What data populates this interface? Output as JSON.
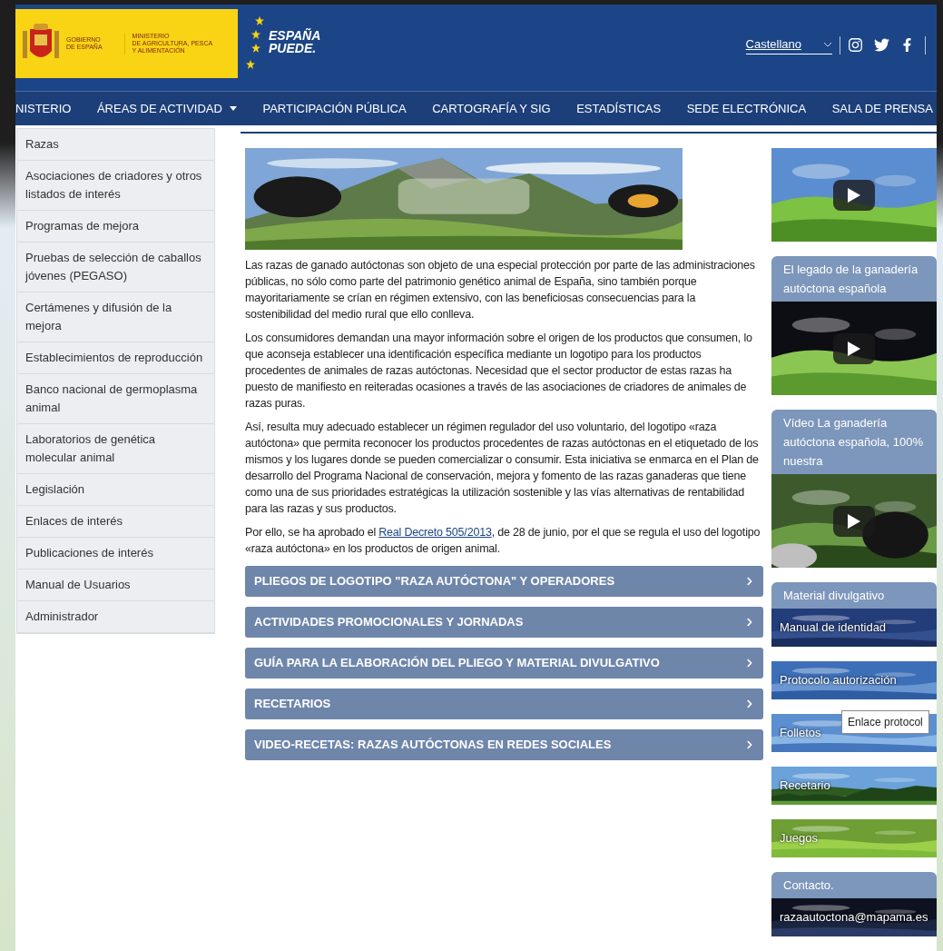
{
  "header": {
    "government_lines": [
      "GOBIERNO",
      "DE ESPAÑA"
    ],
    "ministry_lines": [
      "MINISTERIO",
      "DE AGRICULTURA, PESCA",
      "Y ALIMENTACIÓN"
    ],
    "slogan_lines": [
      "ESPAÑA",
      "PUEDE."
    ],
    "language": {
      "value": "Castellano"
    }
  },
  "nav": [
    {
      "label": "NISTERIO",
      "dropdown": false
    },
    {
      "label": "ÁREAS DE ACTIVIDAD",
      "dropdown": true
    },
    {
      "label": "PARTICIPACIÓN PÚBLICA",
      "dropdown": false
    },
    {
      "label": "CARTOGRAFÍA Y SIG",
      "dropdown": false
    },
    {
      "label": "ESTADÍSTICAS",
      "dropdown": false
    },
    {
      "label": "SEDE ELECTRÓNICA",
      "dropdown": false
    },
    {
      "label": "SALA DE PRENSA",
      "dropdown": false
    }
  ],
  "sidebar": {
    "items": [
      "Razas",
      "Asociaciones de criadores y otros listados de interés",
      "Programas de mejora",
      "Pruebas de selección de caballos jóvenes (PEGASO)",
      "Certámenes y difusión de la mejora",
      "Establecimientos de reproducción",
      "Banco nacional de germoplasma animal",
      "Laboratorios de genética molecular animal",
      "Legislación",
      "Enlaces de interés",
      "Publicaciones de interés",
      "Manual de Usuarios",
      "Administrador"
    ]
  },
  "paragraphs": [
    {
      "kind": "text",
      "text": "Las razas de ganado autóctonas son objeto de una especial protección por parte de las administraciones públicas, no sólo como parte del patrimonio genético animal de España, sino también porque mayoritariamente se crían en régimen extensivo, con las beneficiosas consecuencias para la sostenibilidad del medio rural que ello conlleva."
    },
    {
      "kind": "text",
      "text": "Los consumidores demandan una mayor información sobre el origen de los productos que consumen, lo que aconseja establecer una identificación específica mediante un logotipo para los productos procedentes de animales de razas autóctonas. Necesidad que el sector productor de estas razas ha puesto de manifiesto en reiteradas ocasiones a través de las asociaciones de criadores de animales de razas puras."
    },
    {
      "kind": "text",
      "text": "Así, resulta muy adecuado establecer un régimen regulador del uso voluntario, del logotipo «raza autóctona» que permita reconocer los productos procedentes de razas autóctonas en el etiquetado de los mismos y los lugares donde se pueden comercializar o consumir. Esta iniciativa se enmarca en el Plan de desarrollo del Programa Nacional de conservación, mejora y fomento de las razas ganaderas que tiene como una de sus prioridades estratégicas la utilización sostenible y las vías alternativas de rentabilidad para las razas y sus productos."
    },
    {
      "kind": "with_link",
      "before": "Por ello, se ha aprobado el ",
      "link": "Real Decreto 505/2013",
      "after": ", de 28 de junio, por el que se regula el uso del logotipo «raza autóctona» en los productos de origen animal."
    }
  ],
  "sections": [
    "PLIEGOS DE LOGOTIPO \"RAZA AUTÓCTONA\" Y OPERADORES",
    "ACTIVIDADES PROMOCIONALES Y JORNADAS",
    "GUÍA PARA LA ELABORACIÓN DEL PLIEGO Y MATERIAL DIVULGATIVO",
    "RECETARIOS",
    "VIDEO-RECETAS: RAZAS AUTÓCTONAS EN REDES SOCIALES"
  ],
  "panels": [
    {
      "kind": "video"
    },
    {
      "kind": "video",
      "title": "El legado de la ganadería autóctona española"
    },
    {
      "kind": "video",
      "title": "Vídeo La ganadería autóctona española, 100% nuestra"
    },
    {
      "kind": "link",
      "title": "Material divulgativo",
      "label": "Manual de identidad"
    },
    {
      "kind": "link",
      "label": "Protocolo autorización"
    },
    {
      "kind": "link",
      "label": "Folletos",
      "tooltip": "Enlace protocol"
    },
    {
      "kind": "link",
      "label": "Recetario"
    },
    {
      "kind": "link",
      "label": "Juegos"
    },
    {
      "kind": "link",
      "title": "Contacto.",
      "label": "razaautoctona@mapama.es"
    }
  ]
}
